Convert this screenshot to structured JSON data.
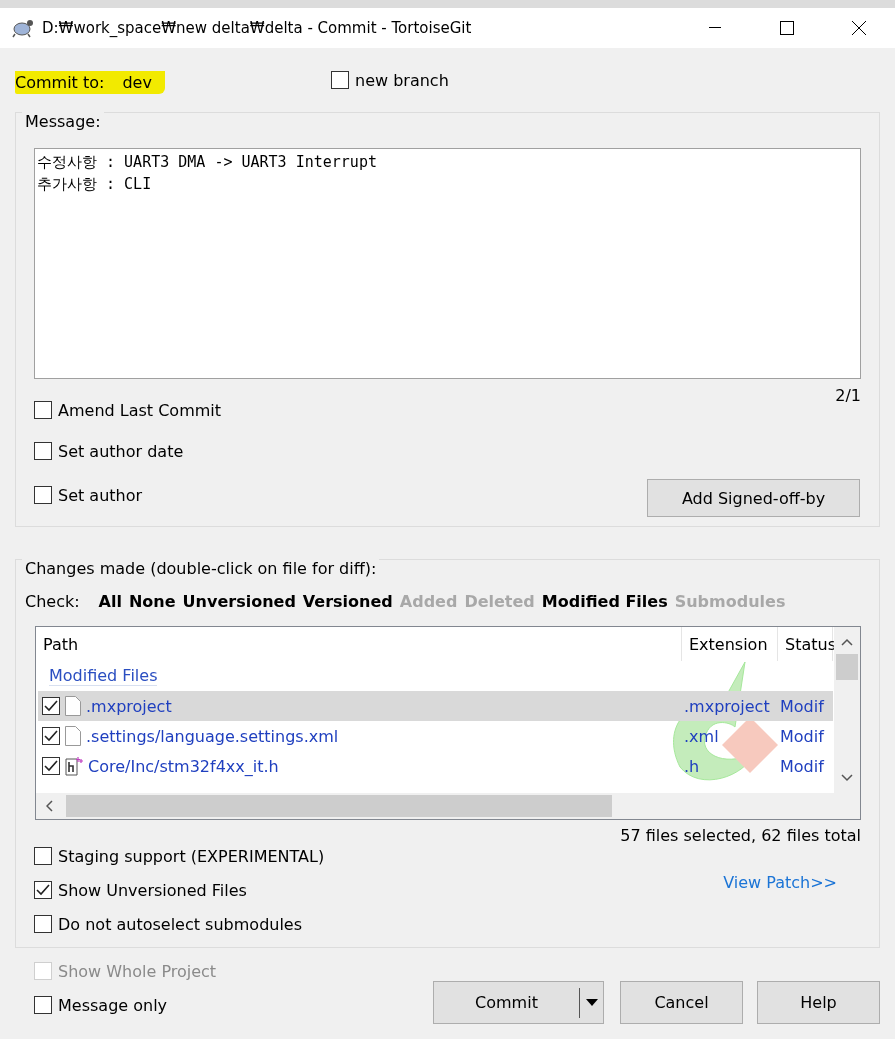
{
  "window": {
    "title": "D:₩work_space₩new delta₩delta - Commit - TortoiseGit"
  },
  "commit_to": {
    "label": "Commit to:",
    "branch": "dev",
    "highlighted": true
  },
  "new_branch": {
    "label": "new branch",
    "checked": false
  },
  "message": {
    "label": "Message:",
    "lines": [
      "수정사항 : UART3 DMA -> UART3 Interrupt",
      "추가사항 : CLI"
    ],
    "counter": "2/1"
  },
  "message_options": [
    {
      "label": "Amend Last Commit",
      "checked": false
    },
    {
      "label": "Set author date",
      "checked": false
    },
    {
      "label": "Set author",
      "checked": false
    }
  ],
  "signoff_button": "Add Signed-off-by",
  "changes": {
    "label": "Changes made (double-click on file for diff):",
    "check_label": "Check:",
    "filters": [
      {
        "label": "All",
        "disabled": false
      },
      {
        "label": "None",
        "disabled": false
      },
      {
        "label": "Unversioned",
        "disabled": false
      },
      {
        "label": "Versioned",
        "disabled": false
      },
      {
        "label": "Added",
        "disabled": true
      },
      {
        "label": "Deleted",
        "disabled": true
      },
      {
        "label": "Modified Files",
        "disabled": false
      },
      {
        "label": "Submodules",
        "disabled": true
      }
    ],
    "columns": [
      "Path",
      "Extension",
      "Status"
    ],
    "group": "Modified Files",
    "rows": [
      {
        "kind": "plain",
        "path": ".mxproject",
        "extension": ".mxproject",
        "status": "Modif",
        "checked": true,
        "selected": true
      },
      {
        "kind": "plain",
        "path": ".settings/language.settings.xml",
        "extension": ".xml",
        "status": "Modif",
        "checked": true,
        "selected": false
      },
      {
        "kind": "header",
        "path": "Core/Inc/stm32f4xx_it.h",
        "extension": ".h",
        "status": "Modif",
        "checked": true,
        "selected": false
      }
    ],
    "summary": "57 files selected, 62 files total",
    "options": [
      {
        "label": "Staging support (EXPERIMENTAL)",
        "checked": false
      },
      {
        "label": "Show Unversioned Files",
        "checked": true
      },
      {
        "label": "Do not autoselect submodules",
        "checked": false
      }
    ],
    "view_patch": "View Patch>>"
  },
  "bottom_options": [
    {
      "label": "Show Whole Project",
      "checked": false,
      "disabled": true
    },
    {
      "label": "Message only",
      "checked": false,
      "disabled": false
    }
  ],
  "buttons": [
    {
      "kind": "split",
      "label": "Commit"
    },
    {
      "kind": "plain",
      "label": "Cancel"
    },
    {
      "kind": "plain",
      "label": "Help"
    }
  ]
}
